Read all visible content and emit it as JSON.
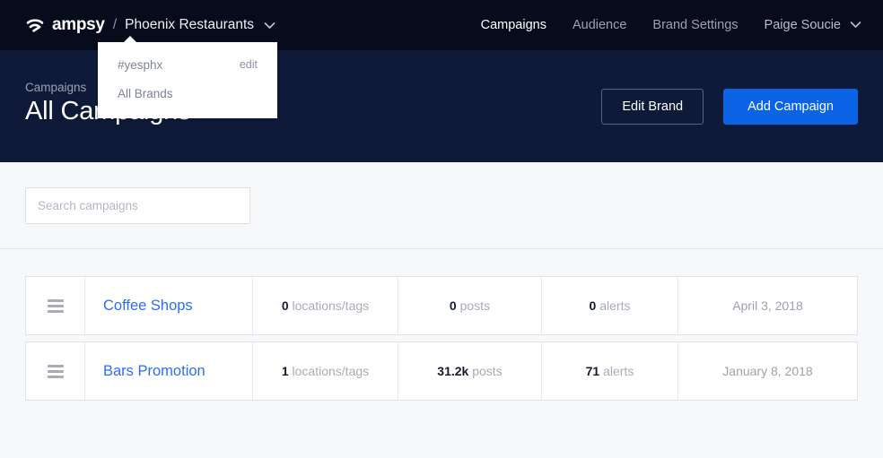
{
  "topbar": {
    "logo_icon": "ampsy-broadcast-icon",
    "logo_word": "ampsy",
    "separator": "/",
    "brand_name": "Phoenix Restaurants",
    "brand_caret_icon": "chevron-down-icon",
    "nav": [
      {
        "label": "Campaigns",
        "active": true
      },
      {
        "label": "Audience",
        "active": false
      },
      {
        "label": "Brand Settings",
        "active": false
      }
    ],
    "user": {
      "name": "Paige Soucie",
      "caret_icon": "chevron-down-icon"
    }
  },
  "brand_dropdown": {
    "open": true,
    "items": [
      {
        "label": "#yesphx",
        "action": "edit"
      },
      {
        "label": "All Brands",
        "action": ""
      }
    ]
  },
  "hero": {
    "breadcrumb": "Campaigns",
    "title": "All Campaigns",
    "edit_brand_label": "Edit Brand",
    "add_campaign_label": "Add Campaign"
  },
  "search": {
    "value": "",
    "placeholder": "Search campaigns"
  },
  "table": {
    "rows": [
      {
        "handle_icon": "drag-handle-icon",
        "name": "Coffee Shops",
        "locations_value": "0",
        "locations_label": "locations/tags",
        "posts_value": "0",
        "posts_label": "posts",
        "alerts_value": "0",
        "alerts_label": "alerts",
        "date": "April 3, 2018"
      },
      {
        "handle_icon": "drag-handle-icon",
        "name": "Bars Promotion",
        "locations_value": "1",
        "locations_label": "locations/tags",
        "posts_value": "31.2k",
        "posts_label": "posts",
        "alerts_value": "71",
        "alerts_label": "alerts",
        "date": "January 8, 2018"
      }
    ]
  },
  "colors": {
    "topbar_bg": "#070c1d",
    "hero_bg": "#0e1a38",
    "accent_blue": "#0b63e5",
    "link_blue": "#2b6ef3",
    "page_bg": "#f7f8fa"
  }
}
